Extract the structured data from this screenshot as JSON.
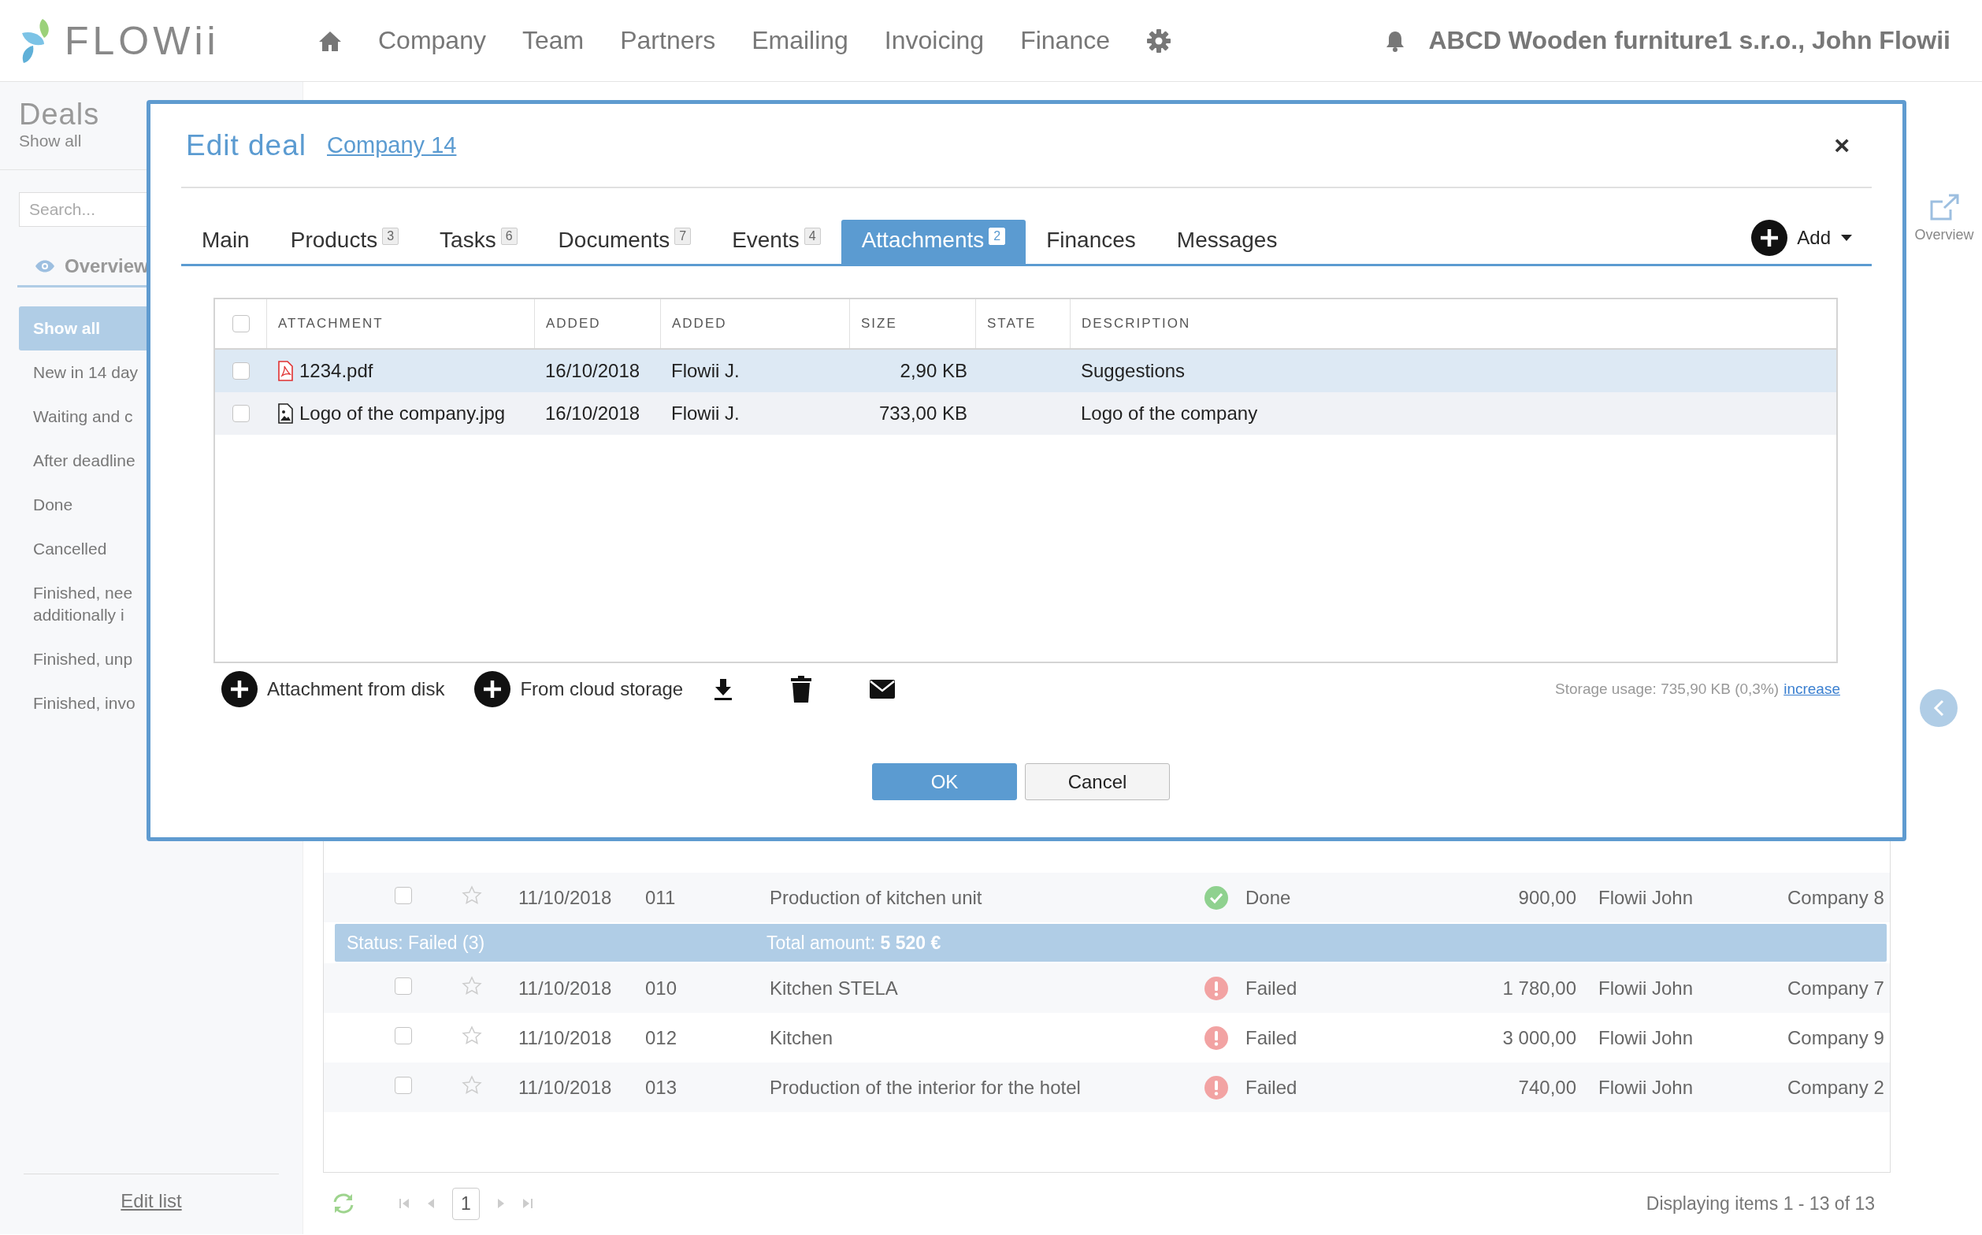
{
  "top_bar": {
    "logo": "FLOWii",
    "nav": [
      "Company",
      "Team",
      "Partners",
      "Emailing",
      "Invoicing",
      "Finance"
    ],
    "account": "ABCD Wooden furniture1 s.r.o., John Flowii"
  },
  "sidebar": {
    "title": "Deals",
    "subtitle": "Show all",
    "search": {
      "placeholder": "Search..."
    },
    "tab": "Overview",
    "items": [
      {
        "label": "Show all",
        "selected": true
      },
      {
        "label": "New in 14 day",
        "selected": false
      },
      {
        "label": "Waiting and c",
        "selected": false
      },
      {
        "label": "After deadline",
        "selected": false
      },
      {
        "label": "Done",
        "selected": false
      },
      {
        "label": "Cancelled",
        "selected": false
      },
      {
        "label": "Finished, nee\nadditionally i",
        "selected": false
      },
      {
        "label": "Finished, unp",
        "selected": false
      },
      {
        "label": "Finished, invo",
        "selected": false
      }
    ],
    "edit_link": "Edit list"
  },
  "deals_table": {
    "rows": [
      {
        "kind": "deal",
        "checked": false,
        "starred": false,
        "date": "11/10/2018",
        "number": "011",
        "name": "Production of kitchen unit",
        "status": {
          "kind": "done",
          "label": "Done"
        },
        "amount": "900,00",
        "owner": "Flowii John",
        "company": "Company 8"
      },
      {
        "kind": "group",
        "label": "Status: Failed (3)",
        "total": "Total amount: **5 520 €**"
      },
      {
        "kind": "deal",
        "checked": false,
        "starred": false,
        "date": "11/10/2018",
        "number": "010",
        "name": "Kitchen STELA",
        "status": {
          "kind": "failed",
          "label": "Failed"
        },
        "amount": "1 780,00",
        "owner": "Flowii John",
        "company": "Company 7"
      },
      {
        "kind": "deal",
        "checked": false,
        "starred": false,
        "date": "11/10/2018",
        "number": "012",
        "name": "Kitchen",
        "status": {
          "kind": "failed",
          "label": "Failed"
        },
        "amount": "3 000,00",
        "owner": "Flowii John",
        "company": "Company 9"
      },
      {
        "kind": "deal",
        "checked": false,
        "starred": false,
        "date": "11/10/2018",
        "number": "013",
        "name": "Production of the interior for the hotel",
        "status": {
          "kind": "failed",
          "label": "Failed"
        },
        "amount": "740,00",
        "owner": "Flowii John",
        "company": "Company 2"
      }
    ],
    "pagination": {
      "page": "1",
      "summary": "Displaying items 1 - 13 of 13"
    }
  },
  "right_rail": {
    "overview": "Overview"
  },
  "modal": {
    "title": "Edit deal",
    "link": "Company 14",
    "close": "×",
    "tabs": [
      {
        "label": "Main",
        "selected": false
      },
      {
        "label": "Products",
        "count": "3",
        "selected": false
      },
      {
        "label": "Tasks",
        "count": "6",
        "selected": false
      },
      {
        "label": "Documents",
        "count": "7",
        "selected": false
      },
      {
        "label": "Events",
        "count": "4",
        "selected": false
      },
      {
        "label": "Attachments",
        "count": "2",
        "selected": true
      },
      {
        "label": "Finances",
        "selected": false
      },
      {
        "label": "Messages",
        "selected": false
      }
    ],
    "add": "Add",
    "select_all": {
      "checked": false
    },
    "columns": [
      "ATTACHMENT",
      "ADDED",
      "ADDED",
      "SIZE",
      "STATE",
      "DESCRIPTION"
    ],
    "rows": [
      {
        "kind": "pdf",
        "checked": false,
        "selected": true,
        "cells": [
          "1234.pdf",
          "16/10/2018",
          "Flowii J.",
          "2,90 KB",
          "",
          "Suggestions"
        ]
      },
      {
        "kind": "image",
        "checked": false,
        "selected": false,
        "cells": [
          "Logo of the company.jpg",
          "16/10/2018",
          "Flowii J.",
          "733,00 KB",
          "",
          "Logo of the company"
        ]
      }
    ],
    "actions": [
      {
        "kind": "add",
        "label": "Attachment from disk"
      },
      {
        "kind": "add",
        "label": "From cloud storage"
      },
      {
        "kind": "download"
      },
      {
        "kind": "delete"
      },
      {
        "kind": "email"
      }
    ],
    "storage": "Storage usage: 735,90 KB (0,3%)",
    "storage_link": "increase",
    "ok": "OK",
    "cancel": "Cancel"
  }
}
